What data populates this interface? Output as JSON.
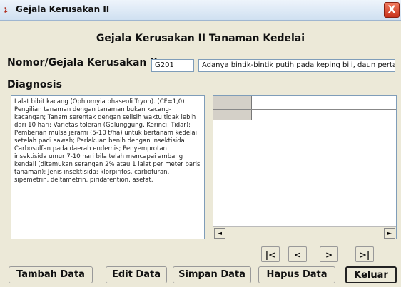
{
  "window": {
    "title": "Gejala Kerusakan II",
    "close_label": "X",
    "app_icon": "app-icon"
  },
  "heading": "Gejala Kerusakan II Tanaman Kedelai",
  "nomor": {
    "label": "Nomor/Gejala Kerusakan II",
    "code": "G201",
    "description": "Adanya bintik-bintik putih pada keping biji, daun perta"
  },
  "diagnosis": {
    "label": "Diagnosis",
    "text": "Lalat bibit kacang (Ophiomyia phaseoli Tryon). (CF=1,0) Pengilian tanaman dengan tanaman bukan kacang-kacangan; Tanam serentak dengan selisih waktu tidak lebih dari 10 hari; Varietas toleran (Galunggung, Kerinci, Tidar); Pemberian mulsa jerami (5-10 t/ha) untuk bertanam kedelai setelah padi sawah; Perlakuan benih dengan insektisida Carbosulfan pada daerah endemis; Penyemprotan insektisida umur 7-10 hari bila telah mencapai ambang kendali (ditemukan serangan 2% atau 1 lalat per meter baris tanaman); Jenis insektisida: klorpirifos, carbofuran, sipemetrin, deltametrin, piridafention, asefat."
  },
  "grid": {
    "scroll_left": "◄",
    "scroll_right": "►"
  },
  "nav": {
    "first": "|<",
    "prev": "<",
    "next": ">",
    "last": ">|"
  },
  "buttons": {
    "tambah": "Tambah Data",
    "edit": "Edit Data",
    "simpan": "Simpan Data",
    "hapus": "Hapus Data",
    "keluar": "Keluar"
  }
}
